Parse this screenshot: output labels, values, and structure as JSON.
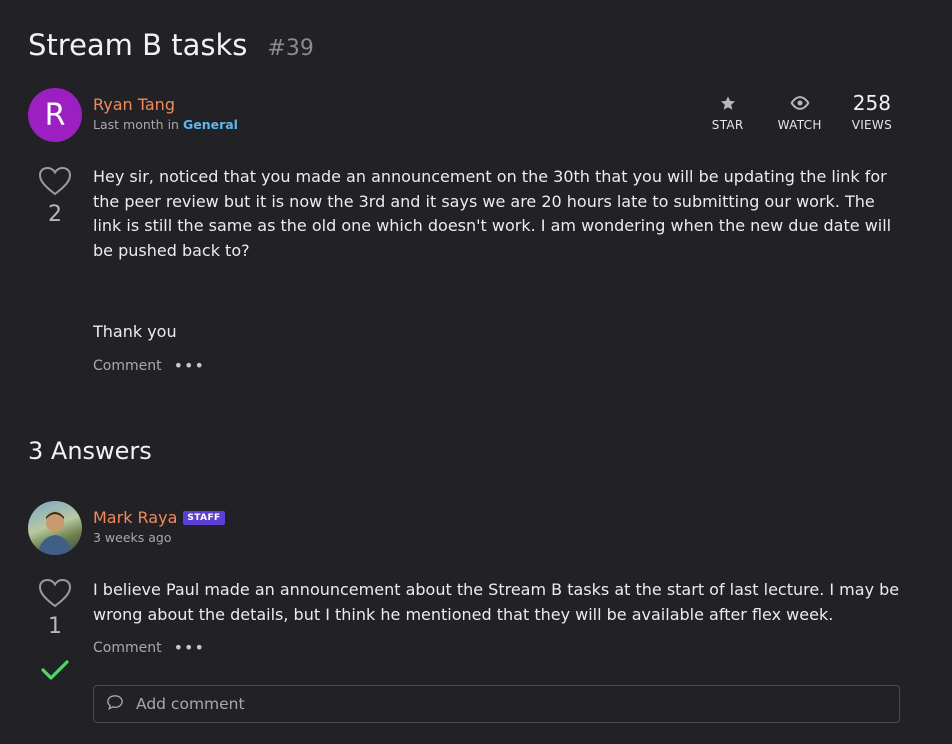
{
  "question": {
    "title": "Stream B tasks",
    "number": "#39",
    "avatar_initial": "R",
    "author": "Ryan Tang",
    "time": "Last month",
    "in_word": "in",
    "category": "General",
    "stats": {
      "star_label": "STAR",
      "watch_label": "WATCH",
      "views_count": "258",
      "views_label": "VIEWS"
    },
    "likes": "2",
    "paragraphs": [
      "Hey sir, noticed that you made an announcement on the 30th that you will be updating the link for the peer review but it is now the 3rd and it says we are 20 hours late to submitting our work. The link is still the same as the old one which doesn't work. I am wondering when the new due date will be pushed back to?",
      "Thank you"
    ],
    "comment_label": "Comment",
    "more_label": "•••"
  },
  "answers_heading": "3 Answers",
  "answer": {
    "author": "Mark Raya",
    "badge": "STAFF",
    "time": "3 weeks ago",
    "likes": "1",
    "text": "I believe Paul made an announcement about the Stream B tasks at the start of last lecture. I may be wrong about the details, but I think he mentioned that they will be available after flex week.",
    "comment_label": "Comment",
    "more_label": "•••",
    "add_comment_placeholder": "Add comment",
    "accepted": true
  },
  "colors": {
    "background": "#222226",
    "author": "#f08a5d",
    "category": "#5bb8f0",
    "avatar": "#9b1fc1",
    "staff_badge": "#5b3fd6",
    "check": "#4cd964"
  },
  "icons": [
    "heart-icon",
    "star-icon",
    "eye-icon",
    "check-icon",
    "comment-bubble-icon"
  ]
}
